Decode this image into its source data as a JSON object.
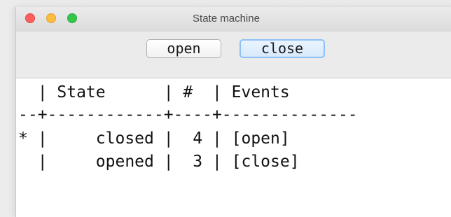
{
  "window": {
    "title": "State machine"
  },
  "toolbar": {
    "buttons": [
      {
        "label": "open"
      },
      {
        "label": "close"
      }
    ]
  },
  "table": {
    "header_line": "  | State      | #  | Events",
    "separator_line": "--+------------+----+--------------",
    "rows": [
      {
        "line": "* |     closed |  4 | [open]",
        "marker": "*",
        "state": "closed",
        "count": "4",
        "events": "[open]"
      },
      {
        "line": "  |     opened |  3 | [close]",
        "marker": "",
        "state": "opened",
        "count": "3",
        "events": "[close]"
      }
    ]
  },
  "colors": {
    "close_traffic_light": "#fc605c",
    "minimize_traffic_light": "#fdbc40",
    "zoom_traffic_light": "#34c84a",
    "focused_button_border": "#8ec0f5"
  }
}
